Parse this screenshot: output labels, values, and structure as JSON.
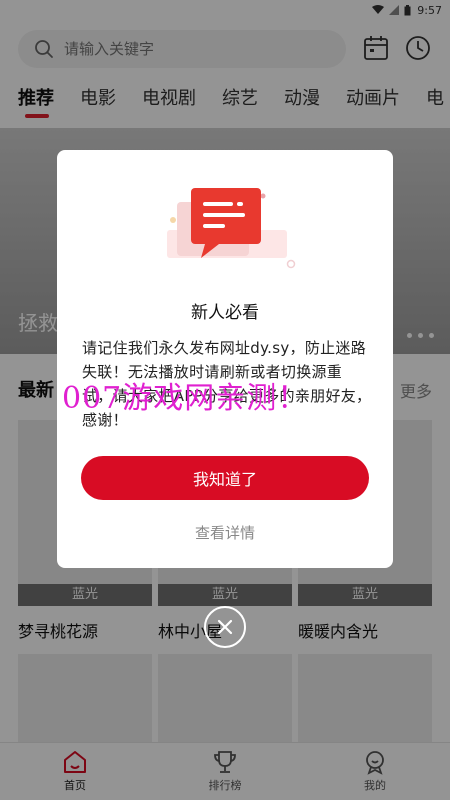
{
  "status_bar": {
    "time": "9:57"
  },
  "header": {
    "search_placeholder": "请输入关键字",
    "icons": [
      "search-icon",
      "calendar-icon",
      "clock-icon"
    ]
  },
  "tabs": [
    {
      "label": "推荐",
      "active": true
    },
    {
      "label": "电影",
      "active": false
    },
    {
      "label": "电视剧",
      "active": false
    },
    {
      "label": "综艺",
      "active": false
    },
    {
      "label": "动漫",
      "active": false
    },
    {
      "label": "动画片",
      "active": false
    },
    {
      "label": "电",
      "active": false
    }
  ],
  "banner": {
    "title": "拯救"
  },
  "section": {
    "title": "最新",
    "more": "更多"
  },
  "cards": [
    {
      "title": "梦寻桃花源",
      "quality": "蓝光"
    },
    {
      "title": "林中小屋",
      "quality": "蓝光"
    },
    {
      "title": "暖暖内含光",
      "quality": "蓝光"
    }
  ],
  "bottom_nav": [
    {
      "label": "首页",
      "icon": "home-icon",
      "active": true
    },
    {
      "label": "排行榜",
      "icon": "trophy-icon",
      "active": false
    },
    {
      "label": "我的",
      "icon": "profile-icon",
      "active": false
    }
  ],
  "dialog": {
    "title": "新人必看",
    "body": "请记住我们永久发布网址dy.sy，防止迷路失联！无法播放时请刷新或者切换源重试，请大家把APP分享给更多的亲朋好友，感谢！",
    "primary_button": "我知道了",
    "secondary_link": "查看详情"
  },
  "watermark": "007游戏网亲测！",
  "colors": {
    "accent": "#d80c24",
    "watermark": "#e020d0"
  }
}
